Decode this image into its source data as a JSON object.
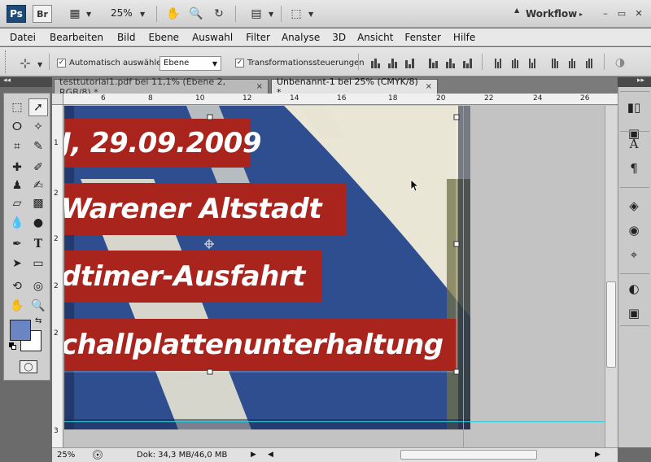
{
  "app": {
    "logo": "Ps",
    "bridge": "Br",
    "zoom": "25%",
    "workspace": "Workflow",
    "window_buttons": [
      "–",
      "▭",
      "✕"
    ]
  },
  "menu": [
    "Datei",
    "Bearbeiten",
    "Bild",
    "Ebene",
    "Auswahl",
    "Filter",
    "Analyse",
    "3D",
    "Ansicht",
    "Fenster",
    "Hilfe"
  ],
  "options": {
    "auto_select_label": "Automatisch auswählen:",
    "auto_select_value": "Ebene",
    "transform_label": "Transformationssteuerungen"
  },
  "tabs": [
    {
      "label": "testtutorial1.pdf bei 11,1% (Ebene 2, RGB/8) *",
      "close": "×"
    },
    {
      "label": "Unbenannt-1 bei 25% (CMYK/8) *",
      "close": "×"
    }
  ],
  "ruler": {
    "h": [
      "6",
      "8",
      "10",
      "12",
      "14",
      "16",
      "18",
      "20",
      "22",
      "24",
      "26"
    ],
    "v": [
      "1",
      "2",
      "2",
      "2",
      "2",
      "3"
    ]
  },
  "canvas": {
    "lines": [
      "J, 29.09.2009",
      "Warener Altstadt",
      "dtimer-Ausfahrt",
      "challplattenunterhaltung"
    ]
  },
  "status": {
    "zoom": "25%",
    "doc": "Dok: 34,3 MB/46,0 MB"
  },
  "colors": {
    "foreground": "#6b84c4",
    "background": "#ffffff",
    "banner_red": "#a8241d",
    "canvas_blue": "#2e4e8f",
    "guide": "#33c9d6"
  }
}
